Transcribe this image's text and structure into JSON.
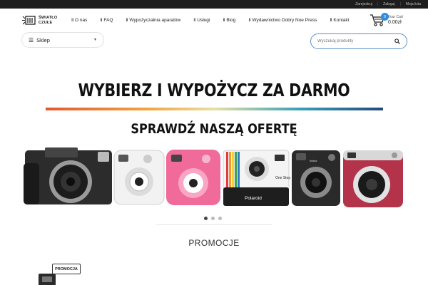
{
  "topbar": {
    "links": [
      "Zarejestruj",
      "Zaloguj",
      "Moja lista"
    ]
  },
  "logo": {
    "line1": "ŚWIATŁO",
    "line2": "CZUŁE"
  },
  "nav": {
    "items": [
      "O nas",
      "FAQ",
      "Wypożyczalnia aparatów",
      "Usługi",
      "Blog",
      "Wydawnictwo Dobry Noe Press",
      "Kontakt"
    ]
  },
  "cart": {
    "count": "0",
    "label": "Your Cart",
    "total": "0.00zł"
  },
  "shop_menu": {
    "label": "Sklep"
  },
  "search": {
    "placeholder": "Wyszukaj produkty"
  },
  "hero": {
    "headline": "WYBIERZ I WYPOŻYCZ ZA DARMO",
    "subheadline": "SPRAWDŹ NASZĄ OFERTĘ",
    "camera_labels": {
      "onestep": "One Step",
      "polaroid": "Polaroid",
      "instax": "instax"
    },
    "slides": 3,
    "active_slide": 1
  },
  "promotions": {
    "title": "PROMOCJE",
    "badge": "PROMOCJA"
  },
  "colors": {
    "accent": "#2f8be0",
    "search_border": "#5a8fc8",
    "topbar": "#1d1d1d"
  }
}
